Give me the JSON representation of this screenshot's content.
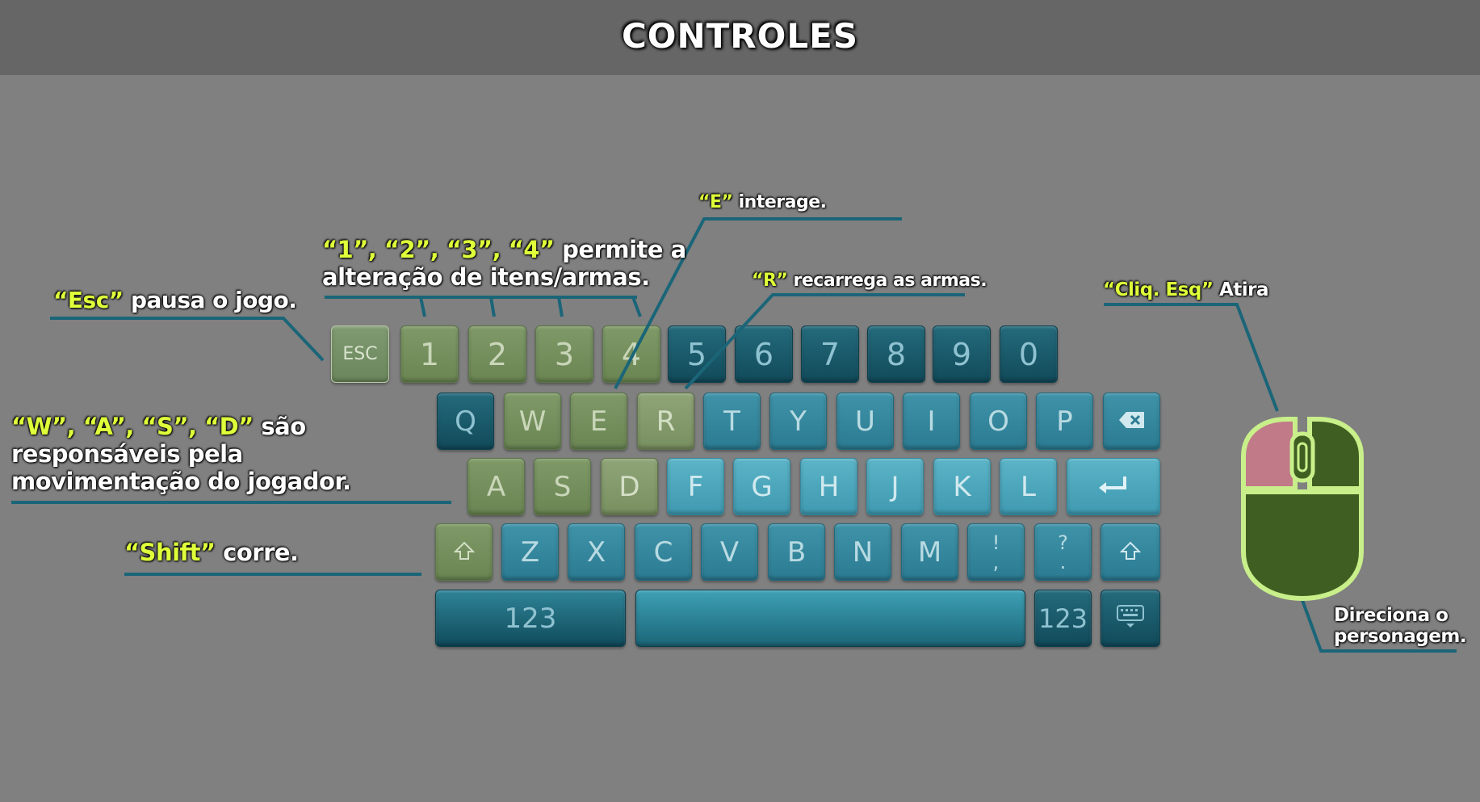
{
  "header": {
    "title": "CONTROLES"
  },
  "annotations": {
    "esc": {
      "hl": "“Esc”",
      "text": " pausa o jogo."
    },
    "nums": {
      "hl": "“1”, “2”, “3”, “4”",
      "text": " permite a",
      "line2": "alteração de itens/armas."
    },
    "e": {
      "hl": "“E”",
      "text": " interage."
    },
    "r": {
      "hl": "“R”",
      "text": " recarrega as armas."
    },
    "wasd": {
      "hl": "“W”, “A”, “S”, “D”",
      "text": " são",
      "line2": "responsáveis pela",
      "line3": "movimentação do jogador."
    },
    "shift": {
      "hl": "“Shift”",
      "text": " corre."
    },
    "click": {
      "hl": "“Cliq. Esq”",
      "text": " Atira"
    },
    "mouse": {
      "line1": "Direciona o",
      "line2": "personagem."
    }
  },
  "keyboard": {
    "row1": [
      "ESC",
      "1",
      "2",
      "3",
      "4",
      "5",
      "6",
      "7",
      "8",
      "9",
      "0"
    ],
    "row2": [
      "Q",
      "W",
      "E",
      "R",
      "T",
      "Y",
      "U",
      "I",
      "O",
      "P"
    ],
    "row3": [
      "A",
      "S",
      "D",
      "F",
      "G",
      "H",
      "J",
      "K",
      "L"
    ],
    "row4": [
      "Z",
      "X",
      "C",
      "V",
      "B",
      "N",
      "M"
    ],
    "punct1": {
      "top": "!",
      "bottom": ","
    },
    "punct2": {
      "top": "?",
      "bottom": "."
    },
    "numbers_left": "123",
    "numbers_right": "123",
    "icons": {
      "backspace": "backspace-icon",
      "enter": "enter-icon",
      "shift": "shift-icon",
      "keyboard": "keyboard-icon"
    },
    "highlighted_keys": [
      "ESC",
      "1",
      "2",
      "3",
      "4",
      "W",
      "E",
      "R",
      "A",
      "S",
      "D",
      "SHIFT-LEFT"
    ]
  },
  "colors": {
    "highlight_text": "#dfff3a",
    "key_green": "#7f9a68",
    "key_teal_dark": "#114a5a",
    "key_teal_light": "#4ea9bd",
    "mouse_outline": "#c8ef8a",
    "mouse_body": "#3f5f22",
    "mouse_left_button": "#c07a88",
    "leader_line": "#1b6578"
  }
}
